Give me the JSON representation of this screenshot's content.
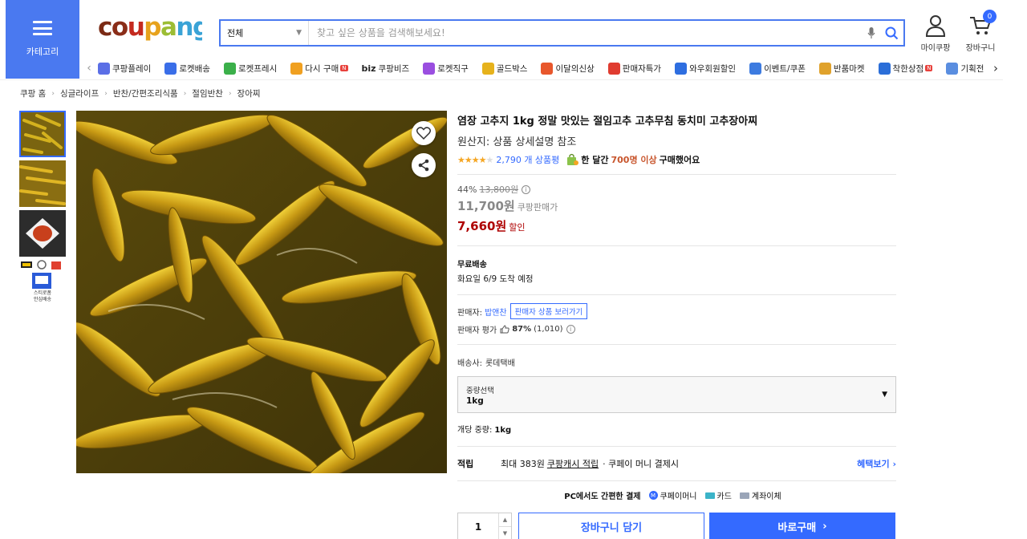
{
  "header": {
    "category_label": "카테고리",
    "search_scope": "전체",
    "search_placeholder": "찾고 싶은 상품을 검색해보세요!",
    "mypage_label": "마이쿠팡",
    "cart_label": "장바구니",
    "cart_count": "0"
  },
  "category_nav": [
    {
      "label": "쿠팡플레이",
      "icon": "play-icon",
      "color": "#5b6fe6"
    },
    {
      "label": "로켓배송",
      "icon": "rocket-icon",
      "color": "#3a6ee8"
    },
    {
      "label": "로켓프레시",
      "icon": "rocket-fresh-icon",
      "color": "#3bb04a"
    },
    {
      "label": "다시 구매",
      "icon": "basket-icon",
      "color": "#f0a020",
      "new": "N"
    },
    {
      "label": "쿠팡비즈",
      "icon": "biz-icon",
      "color": "#333333",
      "prefix": "biz"
    },
    {
      "label": "로켓직구",
      "icon": "globe-icon",
      "color": "#9a4ee0"
    },
    {
      "label": "골드박스",
      "icon": "gold-box-icon",
      "color": "#e6b21c"
    },
    {
      "label": "이달의신상",
      "icon": "new-bag-icon",
      "color": "#e8572c"
    },
    {
      "label": "판매자특가",
      "icon": "percent-icon",
      "color": "#e03c30"
    },
    {
      "label": "와우회원할인",
      "icon": "wow-icon",
      "color": "#2e6ee0"
    },
    {
      "label": "이벤트/쿠폰",
      "icon": "coupon-icon",
      "color": "#3d7be0"
    },
    {
      "label": "반품마켓",
      "icon": "market-icon",
      "color": "#e0a22c"
    },
    {
      "label": "착한상점",
      "icon": "shop-icon",
      "color": "#2b6ed8",
      "new": "N"
    },
    {
      "label": "기획전",
      "icon": "tag-icon",
      "color": "#5a8ee0"
    }
  ],
  "breadcrumb": [
    "쿠팡 홈",
    "싱글라이프",
    "반찬/간편조리식품",
    "절임반찬",
    "장아찌"
  ],
  "product": {
    "title": "염장 고추지 1kg 정말 맛있는 절임고추 고추무침 동치미 고추장아찌",
    "origin": "원산지: 상품 상세설명 참조",
    "rating": 4.5,
    "review_count": "2,790 개 상품평",
    "bought_prefix": "한 달간",
    "bought_count": "700명 이상",
    "bought_suffix": "구매했어요",
    "discount_rate": "44%",
    "original_price": "13,800원",
    "coupang_price": "11,700원",
    "coupang_price_label": "쿠팡판매가",
    "sale_price": "7,660원",
    "sale_label": "할인",
    "shipping_title": "무료배송",
    "delivery": "화요일 6/9 도착 예정",
    "seller_label": "판매자:",
    "seller_name": "밥앤찬",
    "seller_button": "판매자 상품 보러가기",
    "seller_rating_label": "판매자 평가",
    "seller_rating": "87%",
    "seller_rating_count": "(1,010)",
    "carrier_label": "배송사:",
    "carrier": "롯데택배",
    "option_label": "중량선택",
    "option_value": "1kg",
    "unit_weight_label": "개당 중량:",
    "unit_weight": "1kg",
    "reward_title": "적립",
    "reward_max": "최대 383원",
    "reward_cash": "쿠팡캐시 적립",
    "reward_pay": "· 쿠페이 머니 결제시",
    "reward_more": "혜택보기",
    "pay_title": "PC에서도 간편한 결제",
    "pay_methods": [
      "쿠페이머니",
      "카드",
      "계좌이체"
    ],
    "quantity": "1",
    "cart_button": "장바구니 담기",
    "buy_button": "바로구매"
  },
  "thumbnail_text": [
    "스티로폼",
    "안심배송"
  ],
  "colors": {
    "accent": "#346aff",
    "category_bg": "#4a79f0",
    "sale_red": "#ae0000"
  }
}
